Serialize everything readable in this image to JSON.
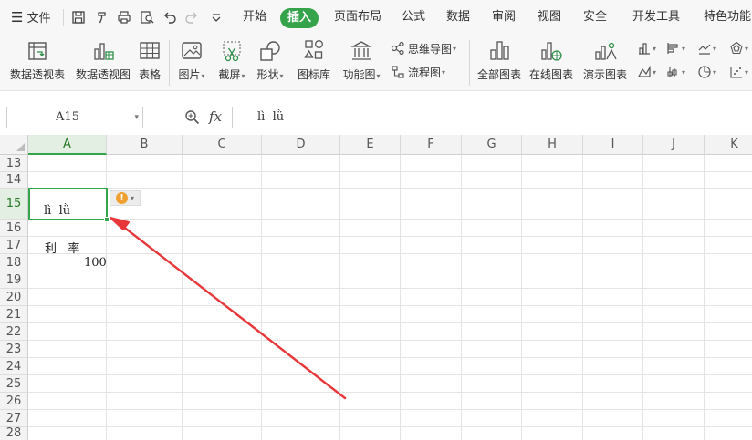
{
  "menu": {
    "file_label": "文件",
    "tabs": [
      "开始",
      "插入",
      "页面布局",
      "公式",
      "数据",
      "审阅",
      "视图",
      "安全",
      "开发工具",
      "特色功能"
    ],
    "active_tab": "插入"
  },
  "ribbon": {
    "pivot_table": "数据透视表",
    "pivot_chart": "数据透视图",
    "table": "表格",
    "picture": "图片",
    "screenshot": "截屏",
    "shapes": "形状",
    "icon_library": "图标库",
    "function_chart": "功能图",
    "mind_map": "思维导图",
    "flowchart": "流程图",
    "all_charts": "全部图表",
    "online_charts": "在线图表",
    "demo_charts": "演示图表"
  },
  "formula_bar": {
    "name_box": "A15",
    "fx_label": "fx",
    "formula": "lì  lǜ"
  },
  "sheet": {
    "columns": [
      "A",
      "B",
      "C",
      "D",
      "E",
      "F",
      "G",
      "H",
      "I",
      "J",
      "K"
    ],
    "selected_column": "A",
    "rows": [
      "13",
      "14",
      "15",
      "16",
      "17",
      "18",
      "19",
      "20",
      "21",
      "22",
      "23",
      "24",
      "25",
      "26",
      "27",
      "28"
    ],
    "selected_row": "15",
    "cells": {
      "A15": "lì  lǜ",
      "A17": "利   率",
      "A18": "100"
    },
    "smart_tag_icon": "!"
  },
  "annotation": {
    "arrow_color": "#e8373a",
    "accent_color": "#35a34a"
  }
}
